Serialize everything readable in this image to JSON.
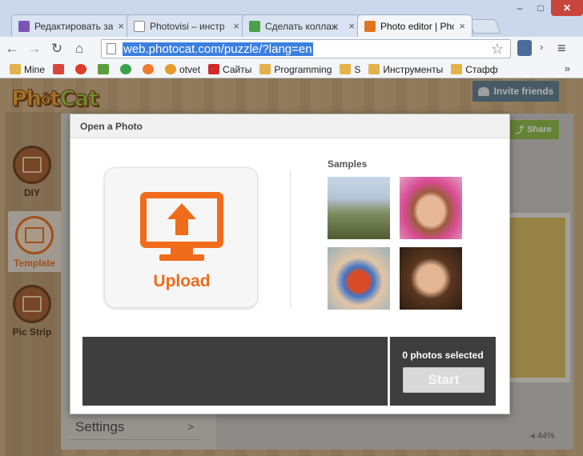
{
  "browser": {
    "tabs": [
      {
        "label": "Редактировать за",
        "icon": "doc-purple-icon",
        "color": "#7a55b5"
      },
      {
        "label": "Photovisi – инстр",
        "icon": "page-icon",
        "color": "#ffffff"
      },
      {
        "label": "Сделать коллаж",
        "icon": "arrow-green-icon",
        "color": "#4aa14a"
      },
      {
        "label": "Photo editor | Pho",
        "icon": "photocat-icon",
        "color": "#e37520"
      }
    ],
    "url": "web.photocat.com/puzzle/?lang=en",
    "window_controls": {
      "minimize": "–",
      "maximize": "□",
      "close": "✕"
    },
    "bookmarks": [
      {
        "label": "Mine",
        "icon": "folder-icon"
      },
      {
        "label": "",
        "icon": "gmail-icon"
      },
      {
        "label": "",
        "icon": "huawei-icon"
      },
      {
        "label": "",
        "icon": "evernote-icon"
      },
      {
        "label": "",
        "icon": "earth-icon"
      },
      {
        "label": "",
        "icon": "rss-icon"
      },
      {
        "label": "otvet",
        "icon": "otvet-icon"
      },
      {
        "label": "Сайты",
        "icon": "k-icon"
      },
      {
        "label": "Programming",
        "icon": "folder-icon"
      },
      {
        "label": "S",
        "icon": "folder-icon"
      },
      {
        "label": "Инструменты",
        "icon": "folder-icon"
      },
      {
        "label": "Стафф",
        "icon": "folder-icon"
      }
    ],
    "bookmarks_more": "»"
  },
  "app": {
    "logo_text_a": "Ph",
    "logo_text_b": "t",
    "logo_text_c": "Cat",
    "invite_label": "Invite friends",
    "share_label": "Share",
    "sidebar": [
      {
        "label": "DIY",
        "icon": "photos-icon"
      },
      {
        "label": "Template",
        "icon": "template-icon"
      },
      {
        "label": "Pic Strip",
        "icon": "pic-strip-icon"
      }
    ],
    "settings_label": "Settings",
    "settings_arrow": ">",
    "zoom": "44%",
    "colors": {
      "accent": "#f06b1a",
      "share": "#8dbb42",
      "invite": "#5d7d8f"
    }
  },
  "modal": {
    "title": "Open a Photo",
    "upload_label": "Upload",
    "samples_title": "Samples",
    "samples": [
      {
        "name": "sample-photo-family"
      },
      {
        "name": "sample-photo-girl"
      },
      {
        "name": "sample-photo-painted-hands"
      },
      {
        "name": "sample-photo-woman"
      }
    ],
    "selected_text": "0 photos selected",
    "start_label": "Start"
  }
}
